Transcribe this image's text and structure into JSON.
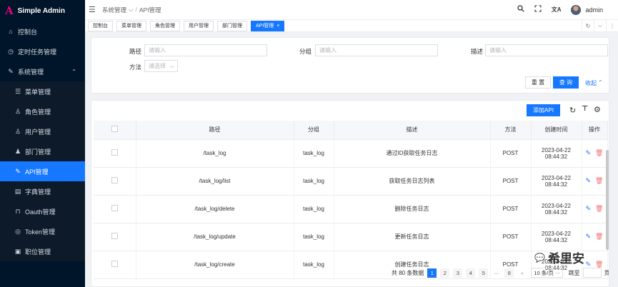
{
  "brand": {
    "logo_mark": "A",
    "title": "Simple Admin"
  },
  "sidebar": {
    "items": [
      {
        "label": "控制台",
        "icon": "dashboard-icon",
        "glyph": "⌂"
      },
      {
        "label": "定时任务管理",
        "icon": "clock-icon",
        "glyph": "◷"
      },
      {
        "label": "系统管理",
        "icon": "wrench-icon",
        "glyph": "✎",
        "expanded": true
      }
    ],
    "subitems": [
      {
        "label": "菜单管理",
        "icon": "list-icon",
        "glyph": "☰"
      },
      {
        "label": "角色管理",
        "icon": "user-icon",
        "glyph": "♙"
      },
      {
        "label": "用户管理",
        "icon": "user-icon",
        "glyph": "♙"
      },
      {
        "label": "部门管理",
        "icon": "org-icon",
        "glyph": "♟"
      },
      {
        "label": "API管理",
        "icon": "link-icon",
        "glyph": "✎",
        "active": true
      },
      {
        "label": "字典管理",
        "icon": "book-icon",
        "glyph": "▤"
      },
      {
        "label": "Oauth管理",
        "icon": "lock-icon",
        "glyph": "⊓"
      },
      {
        "label": "Token管理",
        "icon": "key-icon",
        "glyph": "◎"
      },
      {
        "label": "职位管理",
        "icon": "briefcase-icon",
        "glyph": "▣"
      }
    ]
  },
  "header": {
    "breadcrumb": [
      "系统管理",
      "API管理"
    ],
    "breadcrumb_dropdown": "⌵",
    "breadcrumb_sep": "/",
    "username": "admin"
  },
  "tabs": [
    {
      "label": "控制台"
    },
    {
      "label": "菜单管理"
    },
    {
      "label": "角色管理"
    },
    {
      "label": "用户管理"
    },
    {
      "label": "部门管理"
    },
    {
      "label": "API管理",
      "active": true,
      "close": "×"
    }
  ],
  "search": {
    "path_label": "路径",
    "path_placeholder": "请输入",
    "group_label": "分组",
    "group_placeholder": "请输入",
    "desc_label": "描述",
    "desc_placeholder": "请输入",
    "method_label": "方法",
    "method_placeholder": "请选择",
    "reset_label": "重 置",
    "query_label": "查 询",
    "collapse_label": "收起"
  },
  "table": {
    "add_label": "添加API",
    "columns": [
      "",
      "路径",
      "分组",
      "描述",
      "方法",
      "创建时间",
      "操作"
    ],
    "rows": [
      {
        "path": "/task_log",
        "group": "task_log",
        "desc": "通过ID获取任务日志",
        "method": "POST",
        "date": "2023-04-22",
        "time": "08:44:32"
      },
      {
        "path": "/task_log/list",
        "group": "task_log",
        "desc": "获取任务日志列表",
        "method": "POST",
        "date": "2023-04-22",
        "time": "08:44:32"
      },
      {
        "path": "/task_log/delete",
        "group": "task_log",
        "desc": "删除任务日志",
        "method": "POST",
        "date": "2023-04-22",
        "time": "08:44:32"
      },
      {
        "path": "/task_log/update",
        "group": "task_log",
        "desc": "更新任务日志",
        "method": "POST",
        "date": "2023-04-22",
        "time": "08:44:32"
      },
      {
        "path": "/task_log/create",
        "group": "task_log",
        "desc": "创建任务日志",
        "method": "POST",
        "date": "2023-04-22",
        "time": "08:44:32"
      }
    ]
  },
  "pagination": {
    "total_text": "共 80 条数据",
    "pages": [
      "1",
      "2",
      "3",
      "4",
      "5",
      "···",
      "8"
    ],
    "current": "1",
    "next": "›",
    "page_size": "10 条/页",
    "jump_label": "跳至",
    "page_suffix": "页"
  },
  "watermark": {
    "text": "希里安"
  },
  "colors": {
    "primary": "#1677ff",
    "sidebar_bg": "#001529",
    "danger": "#f56c6c",
    "brand_mark": "#e6007a"
  }
}
